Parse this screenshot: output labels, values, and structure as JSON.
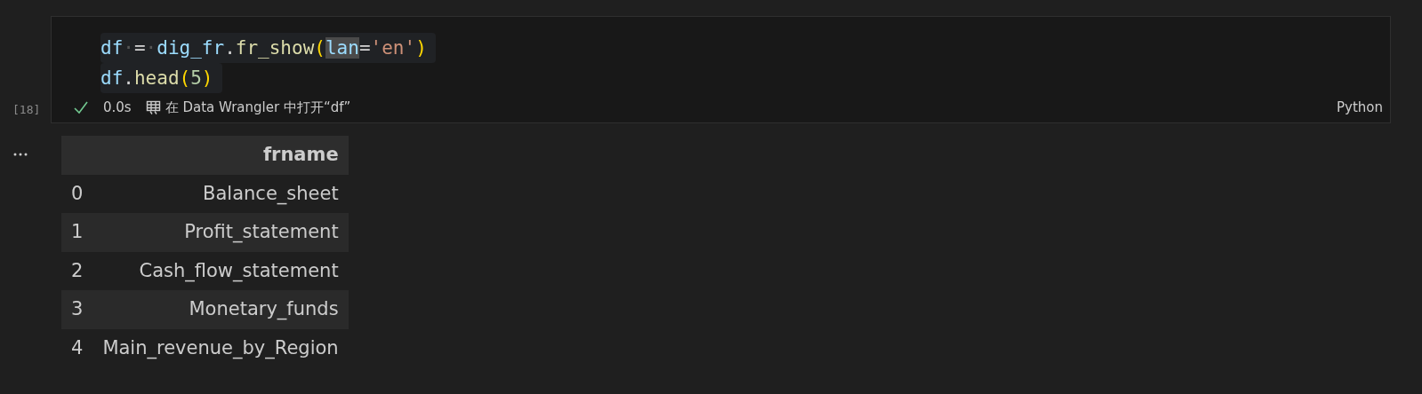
{
  "cell": {
    "execution_count": "[18]",
    "code_lines": [
      {
        "tokens": [
          {
            "text": "df",
            "kind": "var",
            "highlighted": false
          },
          {
            "text": "·",
            "kind": "space",
            "highlighted": false
          },
          {
            "text": "=",
            "kind": "op",
            "highlighted": false
          },
          {
            "text": "·",
            "kind": "space",
            "highlighted": false
          },
          {
            "text": "dig_fr",
            "kind": "var",
            "highlighted": false
          },
          {
            "text": ".",
            "kind": "punc",
            "highlighted": false
          },
          {
            "text": "fr_show",
            "kind": "func",
            "highlighted": false
          },
          {
            "text": "(",
            "kind": "paren",
            "highlighted": false
          },
          {
            "text": "lan",
            "kind": "var",
            "highlighted": true
          },
          {
            "text": "=",
            "kind": "op",
            "highlighted": false
          },
          {
            "text": "'en'",
            "kind": "str",
            "highlighted": false
          },
          {
            "text": ")",
            "kind": "paren",
            "highlighted": false
          }
        ]
      },
      {
        "tokens": [
          {
            "text": "df",
            "kind": "var",
            "highlighted": false
          },
          {
            "text": ".",
            "kind": "punc",
            "highlighted": false
          },
          {
            "text": "head",
            "kind": "func",
            "highlighted": false
          },
          {
            "text": "(",
            "kind": "paren",
            "highlighted": false
          },
          {
            "text": "5",
            "kind": "num",
            "highlighted": false
          },
          {
            "text": ")",
            "kind": "paren",
            "highlighted": false
          }
        ]
      }
    ],
    "status": {
      "succeeded": true,
      "duration": "0.0s",
      "data_wrangler_link": "在 Data Wrangler 中打开“df”",
      "language": "Python"
    }
  },
  "output": {
    "table": {
      "columns": [
        "frname"
      ],
      "rows": [
        {
          "index": "0",
          "values": [
            "Balance_sheet"
          ]
        },
        {
          "index": "1",
          "values": [
            "Profit_statement"
          ]
        },
        {
          "index": "2",
          "values": [
            "Cash_flow_statement"
          ]
        },
        {
          "index": "3",
          "values": [
            "Monetary_funds"
          ]
        },
        {
          "index": "4",
          "values": [
            "Main_revenue_by_Region"
          ]
        }
      ]
    }
  }
}
